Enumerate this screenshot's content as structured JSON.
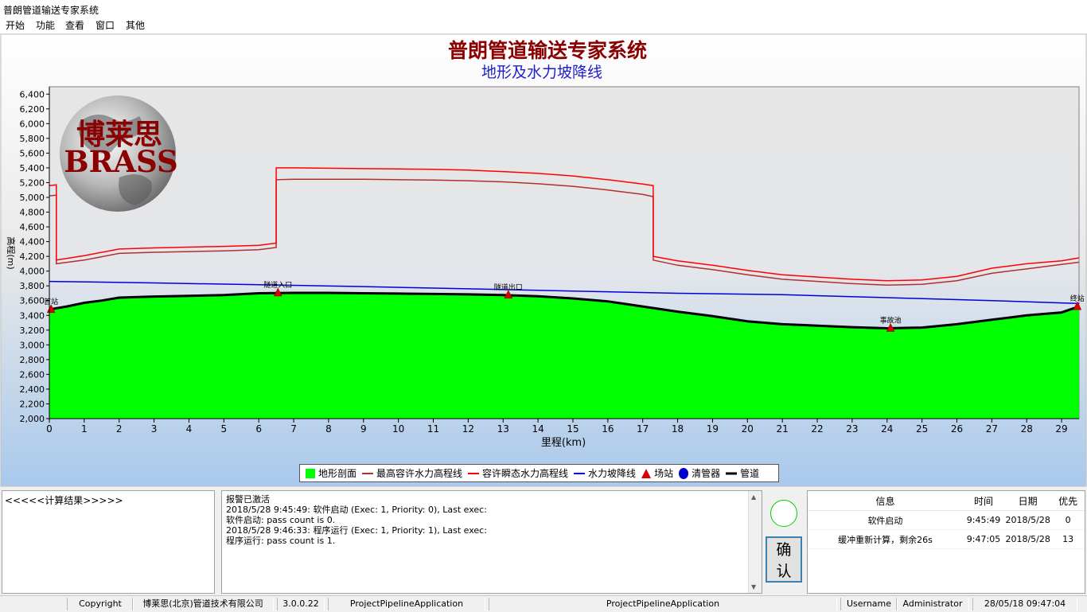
{
  "window": {
    "title": "普朗管道输送专家系统"
  },
  "menu": {
    "items": [
      "开始",
      "功能",
      "查看",
      "窗口",
      "其他"
    ]
  },
  "chart_data": {
    "type": "line",
    "title": "普朗管道输送专家系统",
    "subtitle": "地形及水力坡降线",
    "xlabel": "里程(km)",
    "ylabel": "高程(m)",
    "xlim": [
      0,
      29.5
    ],
    "ylim": [
      2000,
      6500
    ],
    "xticks": [
      0,
      1,
      2,
      3,
      4,
      5,
      6,
      7,
      8,
      9,
      10,
      11,
      12,
      13,
      14,
      15,
      16,
      17,
      18,
      19,
      20,
      21,
      22,
      23,
      24,
      25,
      26,
      27,
      28,
      29
    ],
    "yticks": [
      2000,
      2200,
      2400,
      2600,
      2800,
      3000,
      3200,
      3400,
      3600,
      3800,
      4000,
      4200,
      4400,
      4600,
      4800,
      5000,
      5200,
      5400,
      5600,
      5800,
      6000,
      6200,
      6400
    ],
    "series": [
      {
        "name": "地形剖面",
        "kind": "area",
        "color": "#00ff00",
        "x": [
          0,
          0.5,
          1,
          1.5,
          2,
          3,
          4,
          5,
          6,
          7,
          8,
          9,
          10,
          11,
          12,
          13,
          14,
          15,
          16,
          17,
          18,
          19,
          20,
          21,
          22,
          23,
          24,
          25,
          26,
          27,
          28,
          29,
          29.5
        ],
        "y": [
          3480,
          3520,
          3570,
          3600,
          3640,
          3655,
          3665,
          3675,
          3700,
          3705,
          3705,
          3700,
          3695,
          3690,
          3685,
          3675,
          3660,
          3630,
          3590,
          3520,
          3450,
          3390,
          3320,
          3280,
          3260,
          3240,
          3225,
          3235,
          3280,
          3340,
          3400,
          3440,
          3520
        ]
      },
      {
        "name": "最高容许水力高程线",
        "kind": "line",
        "color": "#b03030",
        "x": [
          0,
          0.2,
          0.2,
          1,
          2,
          3,
          4,
          5,
          6,
          6.5,
          6.5,
          7,
          8,
          9,
          10,
          11,
          12,
          13,
          14,
          15,
          16,
          17,
          17.3,
          17.3,
          18,
          19,
          20,
          21,
          22,
          23,
          24,
          25,
          26,
          27,
          28,
          29,
          29.5
        ],
        "y": [
          5020,
          5030,
          4100,
          4150,
          4240,
          4255,
          4265,
          4275,
          4290,
          4320,
          5240,
          5245,
          5245,
          5245,
          5240,
          5235,
          5225,
          5210,
          5185,
          5150,
          5100,
          5040,
          5010,
          4150,
          4080,
          4020,
          3950,
          3890,
          3860,
          3830,
          3810,
          3820,
          3870,
          3970,
          4030,
          4090,
          4120
        ]
      },
      {
        "name": "容许瞬态水力高程线",
        "kind": "line",
        "color": "#ff0000",
        "x": [
          0,
          0.2,
          0.2,
          1,
          2,
          3,
          4,
          5,
          6,
          6.5,
          6.5,
          7,
          8,
          9,
          10,
          11,
          12,
          13,
          14,
          15,
          16,
          17,
          17.3,
          17.3,
          18,
          19,
          20,
          21,
          22,
          23,
          24,
          25,
          26,
          27,
          28,
          29,
          29.5
        ],
        "y": [
          5160,
          5170,
          4150,
          4210,
          4300,
          4315,
          4325,
          4335,
          4350,
          4380,
          5400,
          5400,
          5395,
          5390,
          5385,
          5380,
          5370,
          5350,
          5325,
          5290,
          5240,
          5180,
          5160,
          4200,
          4140,
          4080,
          4010,
          3950,
          3920,
          3890,
          3870,
          3880,
          3930,
          4040,
          4100,
          4140,
          4180
        ]
      },
      {
        "name": "水力坡降线",
        "kind": "line",
        "color": "#0000dd",
        "x": [
          0,
          3,
          6,
          9,
          12,
          15,
          18,
          21,
          24,
          27,
          29.5
        ],
        "y": [
          3860,
          3840,
          3815,
          3790,
          3760,
          3730,
          3700,
          3680,
          3640,
          3600,
          3560
        ]
      },
      {
        "name": "管道",
        "kind": "line",
        "color": "#000000",
        "x": [
          0,
          0.5,
          1,
          1.5,
          2,
          3,
          4,
          5,
          6,
          7,
          8,
          9,
          10,
          11,
          12,
          13,
          14,
          15,
          16,
          17,
          18,
          19,
          20,
          21,
          22,
          23,
          24,
          25,
          26,
          27,
          28,
          29,
          29.5
        ],
        "y": [
          3480,
          3520,
          3570,
          3600,
          3640,
          3655,
          3665,
          3675,
          3700,
          3705,
          3705,
          3700,
          3695,
          3690,
          3685,
          3675,
          3660,
          3630,
          3590,
          3520,
          3450,
          3390,
          3320,
          3280,
          3260,
          3240,
          3225,
          3235,
          3280,
          3340,
          3400,
          3440,
          3520
        ]
      }
    ],
    "stations": [
      {
        "label": "首站",
        "x": 0.05,
        "y": 3480
      },
      {
        "label": "隧道入口",
        "x": 6.55,
        "y": 3705
      },
      {
        "label": "隧道出口",
        "x": 13.15,
        "y": 3675
      },
      {
        "label": "事故池",
        "x": 24.1,
        "y": 3225
      },
      {
        "label": "终站",
        "x": 29.45,
        "y": 3520
      }
    ],
    "legend": {
      "position": "bottom-center",
      "items": [
        {
          "label": "地形剖面",
          "symbol": "square",
          "color": "#00ff00"
        },
        {
          "label": "最高容许水力高程线",
          "symbol": "line",
          "color": "#b03030"
        },
        {
          "label": "容许瞬态水力高程线",
          "symbol": "line",
          "color": "#ff0000"
        },
        {
          "label": "水力坡降线",
          "symbol": "line",
          "color": "#0000dd"
        },
        {
          "label": "场站",
          "symbol": "triangle",
          "color": "#dd0000"
        },
        {
          "label": "清管器",
          "symbol": "circle",
          "color": "#0000cc"
        },
        {
          "label": "管道",
          "symbol": "thick-line",
          "color": "#000000"
        }
      ]
    },
    "grid": false,
    "watermark": {
      "cn": "博莱思",
      "en": "BRASS"
    }
  },
  "results": {
    "title": "<<<<<计算结果>>>>>"
  },
  "log": {
    "lines": [
      "报警已激活",
      "2018/5/28 9:45:49: 软件启动 (Exec: 1, Priority: 0), Last exec:",
      "软件启动: pass count is 0.",
      "2018/5/28 9:46:33: 程序运行 (Exec: 1, Priority: 1), Last exec:",
      "程序运行: pass count is 1."
    ]
  },
  "confirm_button": {
    "label": "确认"
  },
  "messages": {
    "columns": [
      "信息",
      "时间",
      "日期",
      "优先"
    ],
    "rows": [
      [
        "软件启动",
        "9:45:49",
        "2018/5/28",
        "0"
      ],
      [
        "缓冲重新计算，剩余26s",
        "9:47:05",
        "2018/5/28",
        "13"
      ]
    ]
  },
  "statusbar": {
    "copyright_label": "Copyright",
    "company": "博莱思(北京)管道技术有限公司",
    "version": "3.0.0.22",
    "app1": "ProjectPipelineApplication",
    "app2": "ProjectPipelineApplication",
    "username_label": "Username",
    "username": "Administrator",
    "datetime": "28/05/18 09:47:04"
  }
}
